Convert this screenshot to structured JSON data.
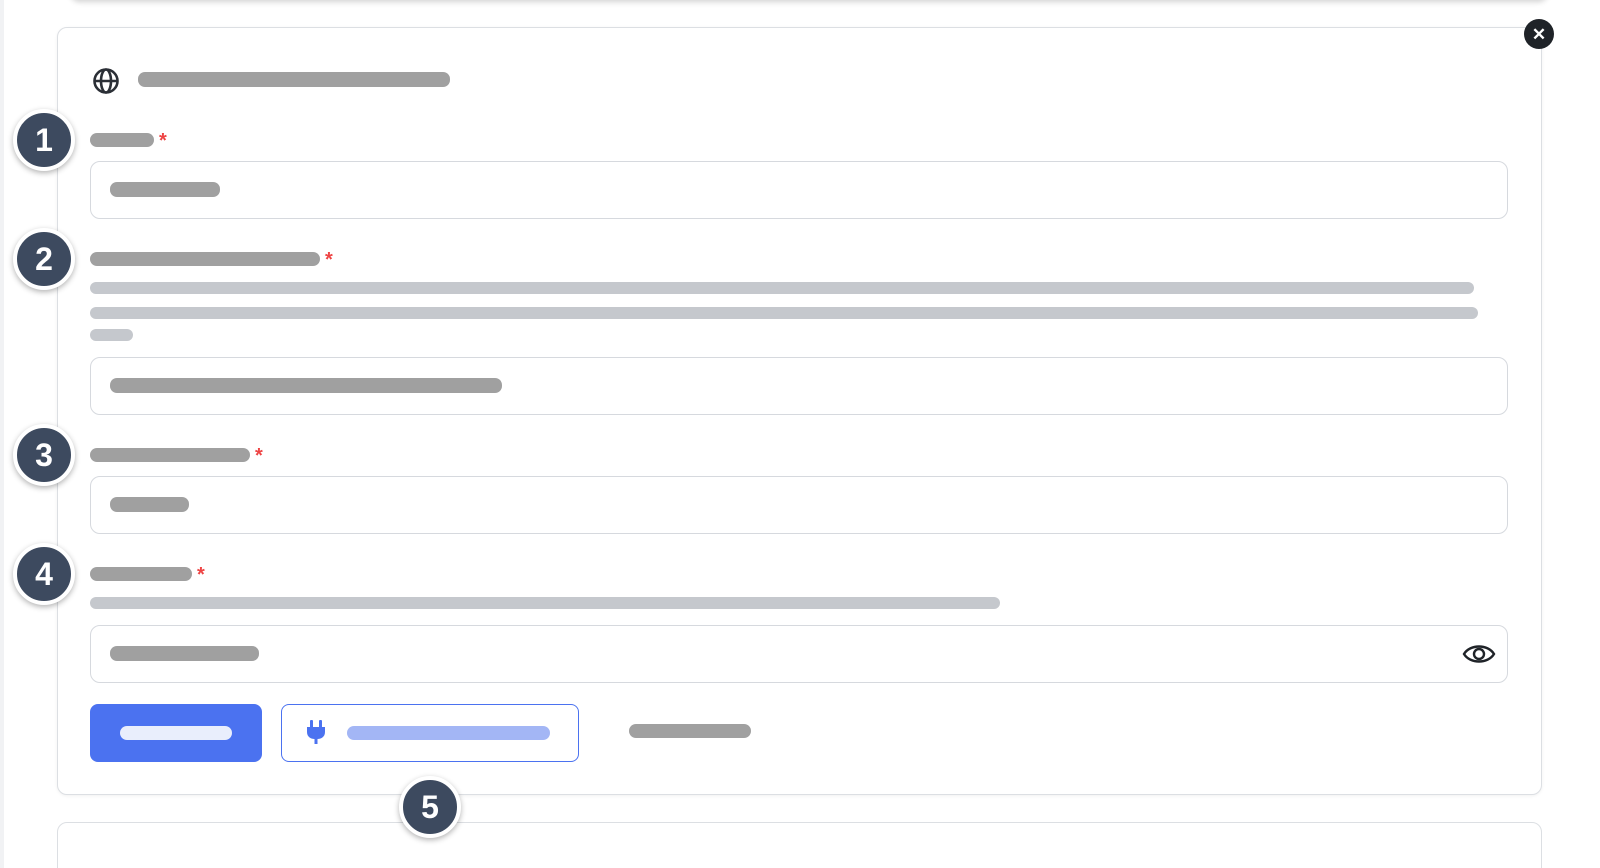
{
  "colors": {
    "accent": "#4b72f0",
    "required": "#ee4444",
    "marker": "#3d4a5f",
    "placeholder_bar": "#a0a0a0",
    "description_bar": "#c5c8cd"
  },
  "icons": {
    "close": "close-icon",
    "globe": "globe-icon",
    "password_toggle": "eye-icon",
    "test_connection": "plug-icon"
  },
  "card": {
    "close_label": "✕"
  },
  "form": {
    "fields": [
      {
        "required_mark": "*"
      },
      {
        "required_mark": "*"
      },
      {
        "required_mark": "*"
      },
      {
        "required_mark": "*"
      }
    ]
  },
  "markers": [
    "1",
    "2",
    "3",
    "4",
    "5"
  ]
}
